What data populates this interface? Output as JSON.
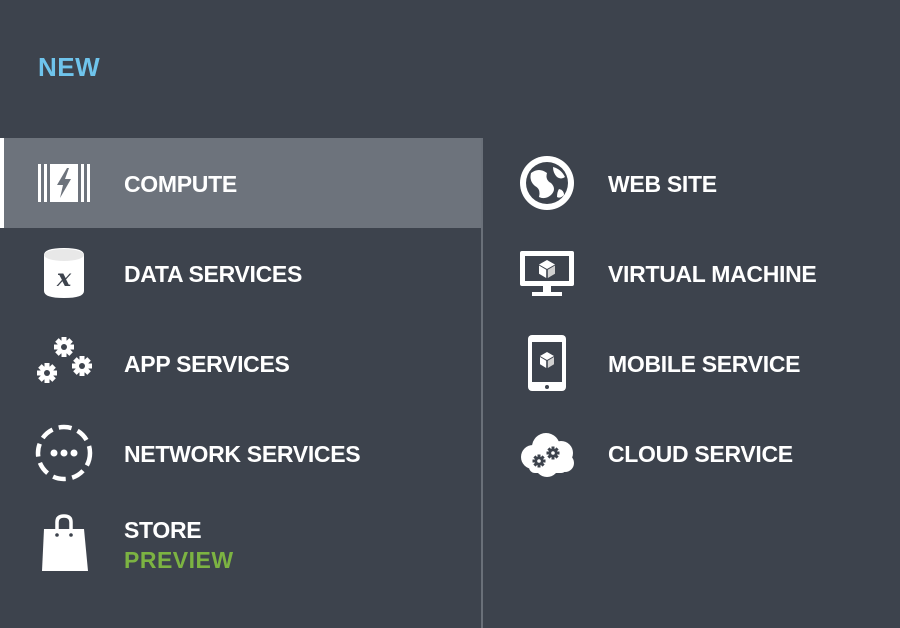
{
  "header": {
    "title": "NEW"
  },
  "categories": [
    {
      "label": "COMPUTE",
      "icon": "compute-icon",
      "selected": true
    },
    {
      "label": "DATA SERVICES",
      "icon": "data-services-icon"
    },
    {
      "label": "APP SERVICES",
      "icon": "gears-icon"
    },
    {
      "label": "NETWORK SERVICES",
      "icon": "network-icon"
    },
    {
      "label": "STORE",
      "sublabel": "PREVIEW",
      "icon": "shopping-bag-icon"
    }
  ],
  "compute_options": [
    {
      "label": "WEB SITE",
      "icon": "globe-icon"
    },
    {
      "label": "VIRTUAL MACHINE",
      "icon": "monitor-icon"
    },
    {
      "label": "MOBILE SERVICE",
      "icon": "mobile-icon"
    },
    {
      "label": "CLOUD SERVICE",
      "icon": "cloud-icon"
    }
  ],
  "colors": {
    "background": "#3d434d",
    "selected_background": "#6d737c",
    "title_accent": "#6fc4ec",
    "preview_accent": "#7cb342",
    "divider": "#6a7079"
  }
}
